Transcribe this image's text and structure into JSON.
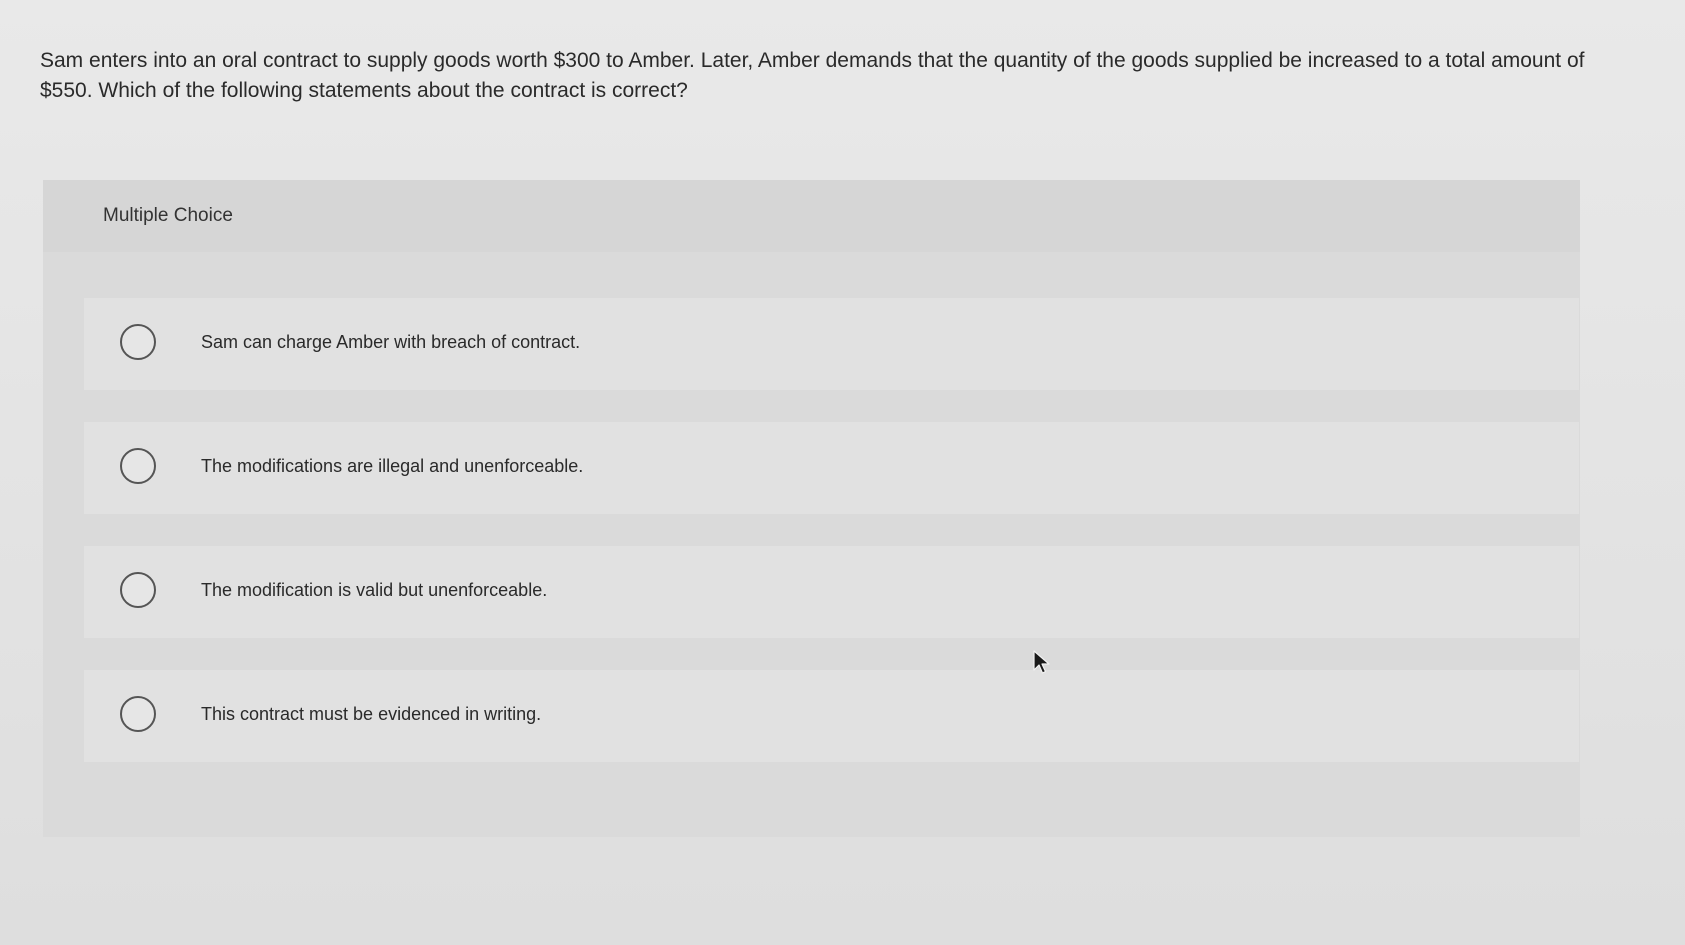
{
  "question": {
    "text": "Sam enters into an oral contract to supply goods worth $300 to Amber. Later, Amber demands that the quantity of the goods supplied be increased to a total amount of $550. Which of the following statements about the contract is correct?"
  },
  "panel": {
    "title": "Multiple Choice"
  },
  "options": [
    {
      "label": "Sam can charge Amber with breach of contract.",
      "selected": false
    },
    {
      "label": "The modifications are illegal and unenforceable.",
      "selected": false
    },
    {
      "label": "The modification is valid but unenforceable.",
      "selected": false
    },
    {
      "label": "This contract must be evidenced in writing.",
      "selected": false
    }
  ],
  "cursor": {
    "icon": "mouse-pointer-icon"
  }
}
